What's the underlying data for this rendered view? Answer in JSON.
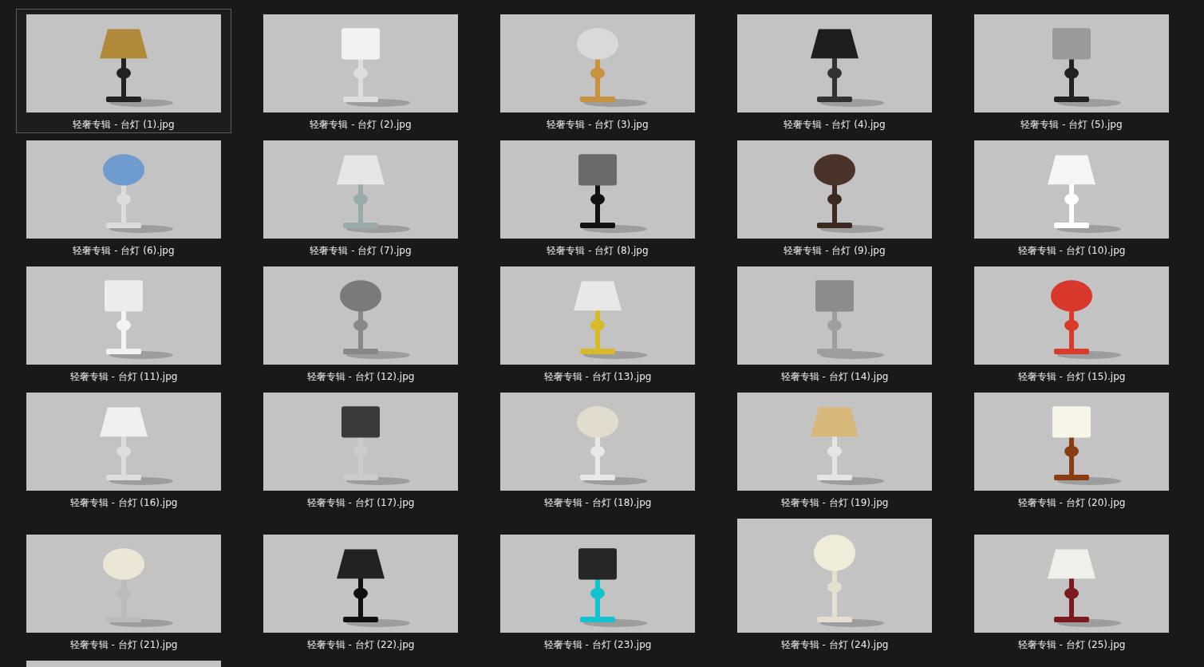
{
  "items": [
    {
      "label": "轻奢专辑 - 台灯 (1).jpg",
      "selected": true,
      "kind": "wide"
    },
    {
      "label": "轻奢专辑 - 台灯 (2).jpg",
      "selected": false,
      "kind": "wide"
    },
    {
      "label": "轻奢专辑 - 台灯 (3).jpg",
      "selected": false,
      "kind": "wide"
    },
    {
      "label": "轻奢专辑 - 台灯 (4).jpg",
      "selected": false,
      "kind": "wide"
    },
    {
      "label": "轻奢专辑 - 台灯 (5).jpg",
      "selected": false,
      "kind": "wide"
    },
    {
      "label": "轻奢专辑 - 台灯 (6).jpg",
      "selected": false,
      "kind": "wide"
    },
    {
      "label": "轻奢专辑 - 台灯 (7).jpg",
      "selected": false,
      "kind": "wide"
    },
    {
      "label": "轻奢专辑 - 台灯 (8).jpg",
      "selected": false,
      "kind": "wide"
    },
    {
      "label": "轻奢专辑 - 台灯 (9).jpg",
      "selected": false,
      "kind": "wide"
    },
    {
      "label": "轻奢专辑 - 台灯 (10).jpg",
      "selected": false,
      "kind": "wide"
    },
    {
      "label": "轻奢专辑 - 台灯 (11).jpg",
      "selected": false,
      "kind": "wide"
    },
    {
      "label": "轻奢专辑 - 台灯 (12).jpg",
      "selected": false,
      "kind": "wide"
    },
    {
      "label": "轻奢专辑 - 台灯 (13).jpg",
      "selected": false,
      "kind": "wide"
    },
    {
      "label": "轻奢专辑 - 台灯 (14).jpg",
      "selected": false,
      "kind": "wide"
    },
    {
      "label": "轻奢专辑 - 台灯 (15).jpg",
      "selected": false,
      "kind": "wide"
    },
    {
      "label": "轻奢专辑 - 台灯 (16).jpg",
      "selected": false,
      "kind": "wide"
    },
    {
      "label": "轻奢专辑 - 台灯 (17).jpg",
      "selected": false,
      "kind": "wide"
    },
    {
      "label": "轻奢专辑 - 台灯 (18).jpg",
      "selected": false,
      "kind": "wide"
    },
    {
      "label": "轻奢专辑 - 台灯 (19).jpg",
      "selected": false,
      "kind": "wide"
    },
    {
      "label": "轻奢专辑 - 台灯 (20).jpg",
      "selected": false,
      "kind": "wide"
    },
    {
      "label": "轻奢专辑 - 台灯 (21).jpg",
      "selected": false,
      "kind": "wide"
    },
    {
      "label": "轻奢专辑 - 台灯 (22).jpg",
      "selected": false,
      "kind": "wide"
    },
    {
      "label": "轻奢专辑 - 台灯 (23).jpg",
      "selected": false,
      "kind": "wide"
    },
    {
      "label": "轻奢专辑 - 台灯 (24).jpg",
      "selected": false,
      "kind": "tall"
    },
    {
      "label": "轻奢专辑 - 台灯 (25).jpg",
      "selected": false,
      "kind": "wide"
    },
    {
      "selected": false,
      "kind": "wide"
    }
  ]
}
